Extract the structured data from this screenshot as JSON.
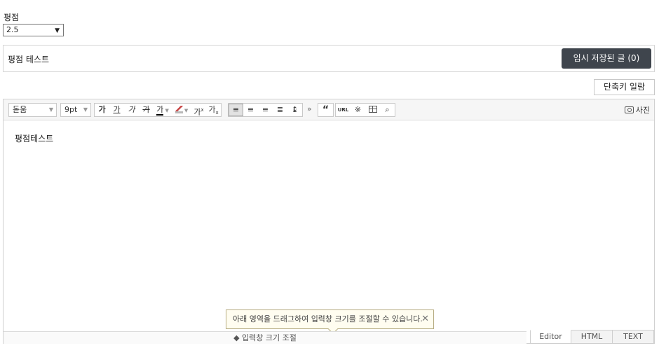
{
  "rating": {
    "label": "평점",
    "selected_value": "2.5"
  },
  "title": {
    "text": "평점 테스트",
    "temp_saved_button": "임시 저장된 글 (0)"
  },
  "shortcut_button": "단축키 일람",
  "toolbar": {
    "font_family": "돋움",
    "font_size": "9pt",
    "bold": "가",
    "underline": "가",
    "italic": "가",
    "strike": "가",
    "text_color": "가",
    "superscript": "가",
    "subscript": "가",
    "more": "»",
    "quote": "“",
    "url": "URL",
    "special_char": "※",
    "photo": "사진"
  },
  "editor": {
    "body_text": "평점테스트"
  },
  "tooltip": {
    "text": "아래 영역을 드래그하여 입력창 크기를 조절할 수 있습니다."
  },
  "resize": {
    "label": "◆ 입력창 크기 조절"
  },
  "modes": {
    "editor": "Editor",
    "html": "HTML",
    "text": "TEXT"
  },
  "colors": {
    "button_dark": "#3f454d",
    "tooltip_bg": "#fffdf0"
  }
}
